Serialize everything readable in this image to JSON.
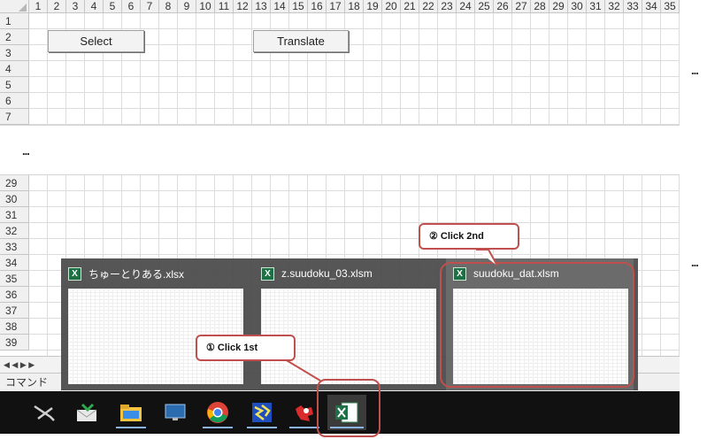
{
  "sheet_top": {
    "columns": [
      "1",
      "2",
      "3",
      "4",
      "5",
      "6",
      "7",
      "8",
      "9",
      "10",
      "11",
      "12",
      "13",
      "14",
      "15",
      "16",
      "17",
      "18",
      "19",
      "20",
      "21",
      "22",
      "23",
      "24",
      "25",
      "26",
      "27",
      "28",
      "29",
      "30",
      "31",
      "32",
      "33",
      "34",
      "35"
    ],
    "rows": [
      "1",
      "2",
      "3",
      "4",
      "5",
      "6",
      "7"
    ],
    "buttons": {
      "select": "Select",
      "translate": "Translate"
    }
  },
  "sheet_bottom": {
    "rows": [
      "29",
      "30",
      "31",
      "32",
      "33",
      "34",
      "35",
      "36",
      "37",
      "38",
      "39"
    ],
    "tab_nav": "◀ ◀ ▶ ▶",
    "status_text": "コマンド"
  },
  "ellipsis": "...",
  "taskbar": {
    "icons": [
      "pen-tool-icon",
      "mail-icon",
      "folder-icon",
      "monitor-icon",
      "chrome-icon",
      "app-icon",
      "puzzle-icon",
      "excel-icon"
    ]
  },
  "previews": [
    {
      "title": "ちゅーとりある.xlsx"
    },
    {
      "title": "z.suudoku_03.xlsm"
    },
    {
      "title": "suudoku_dat.xlsm"
    }
  ],
  "callouts": {
    "first": "① Click  1st",
    "second": "② Click  2nd"
  },
  "colors": {
    "annotation": "#c0504d",
    "taskbar": "#111111",
    "excel_green": "#1e7145"
  }
}
